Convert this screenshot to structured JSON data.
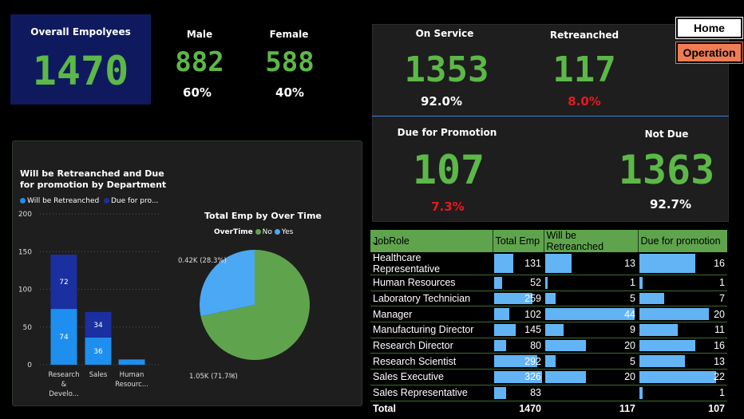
{
  "kpis": {
    "overall_label": "Overall Empolyees",
    "overall_value": "1470",
    "male_label": "Male",
    "male_value": "882",
    "male_pct": "60%",
    "female_label": "Female",
    "female_value": "588",
    "female_pct": "40%",
    "on_service_label": "On Service",
    "on_service_value": "1353",
    "on_service_pct": "92.0%",
    "retreanched_label": "Retreanched",
    "retreanched_value": "117",
    "retreanched_pct": "8.0%",
    "due_label": "Due for Promotion",
    "due_value": "107",
    "due_pct": "7.3%",
    "notdue_label": "Not Due",
    "notdue_value": "1363",
    "notdue_pct": "92.7%"
  },
  "nav": {
    "home": "Home",
    "operation": "Operation"
  },
  "colors": {
    "green": "#5cb847",
    "navy": "#0f1a5e",
    "bar_dark": "#1a2fa0",
    "bar_light": "#1e8fef",
    "pie_green": "#5fa44d",
    "pie_blue": "#4aa8f5",
    "table_bar": "#63b4f5",
    "red": "#e8191c",
    "orange": "#ee7c55"
  },
  "chart_data": [
    {
      "type": "bar",
      "title": "Will be Retreanched and Due for promotion by Department",
      "legend": [
        "Will be Retreanched",
        "Due for pro..."
      ],
      "categories": [
        "Research & Develo...",
        "Sales",
        "Human Resourc..."
      ],
      "series": [
        {
          "name": "Will be Retreanched",
          "values": [
            74,
            36,
            7
          ]
        },
        {
          "name": "Due for promotion",
          "values": [
            72,
            34,
            0
          ]
        }
      ],
      "data_labels": {
        "Will be Retreanched": [
          "74",
          "36",
          ""
        ],
        "Due for promotion": [
          "72",
          "34",
          ""
        ]
      },
      "yticks": [
        "0",
        "50",
        "100",
        "150",
        "200"
      ],
      "ylim": [
        0,
        200
      ],
      "stacked": true,
      "grid": true
    },
    {
      "type": "pie",
      "title": "Total Emp by Over Time",
      "legend_title": "OverTime",
      "legend": [
        "No",
        "Yes"
      ],
      "slices": [
        {
          "label": "No",
          "value": 1054,
          "text": "1.05K (71.7%)"
        },
        {
          "label": "Yes",
          "value": 416,
          "text": "0.42K (28.3%)"
        }
      ]
    }
  ],
  "table": {
    "headers": [
      "JobRole",
      "Total Emp",
      "Will be Retreanched",
      "Due for promotion"
    ],
    "rows": [
      [
        "Healthcare Representative",
        "131",
        "13",
        "16"
      ],
      [
        "Human Resources",
        "52",
        "1",
        "1"
      ],
      [
        "Laboratory Technician",
        "259",
        "5",
        "7"
      ],
      [
        "Manager",
        "102",
        "44",
        "20"
      ],
      [
        "Manufacturing Director",
        "145",
        "9",
        "11"
      ],
      [
        "Research Director",
        "80",
        "20",
        "16"
      ],
      [
        "Research Scientist",
        "292",
        "5",
        "13"
      ],
      [
        "Sales Executive",
        "326",
        "20",
        "22"
      ],
      [
        "Sales Representative",
        "83",
        "",
        "1"
      ]
    ],
    "total": [
      "Total",
      "1470",
      "117",
      "107"
    ],
    "bar_max": [
      326,
      44,
      22
    ]
  }
}
